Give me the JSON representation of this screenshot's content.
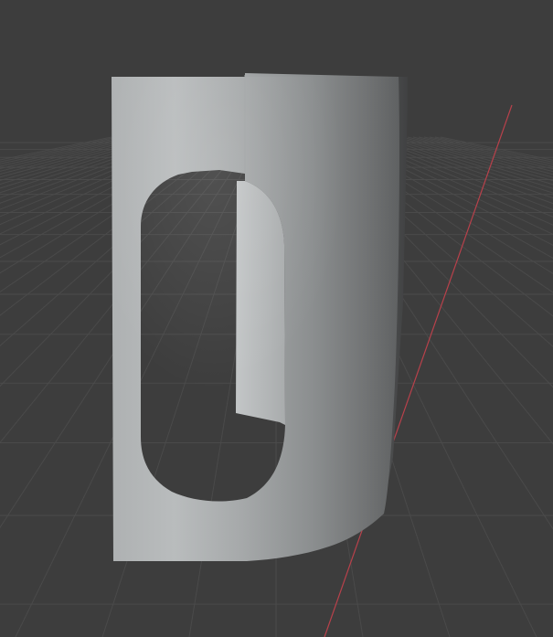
{
  "viewport": {
    "background_color": "#3d3d3d",
    "grid_color": "#4a4a4a",
    "x_axis_color": "#c0404a"
  },
  "object": {
    "type": "curved-panel-with-slot-cutout",
    "light_color": "#b9bcbd",
    "mid_color": "#9fa2a3",
    "dark_color": "#6f7172",
    "edge_color": "#5a5c5d"
  }
}
